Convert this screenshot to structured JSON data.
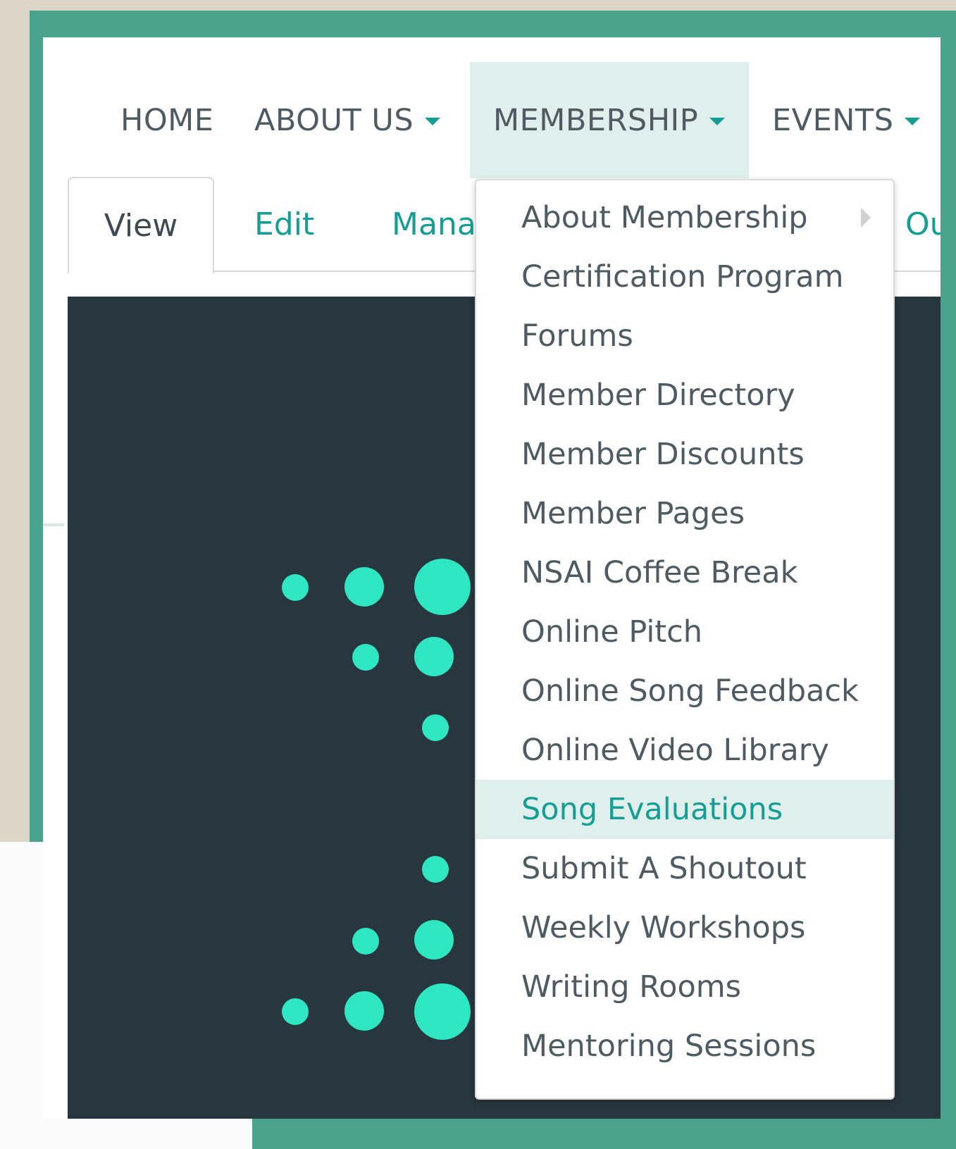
{
  "nav": {
    "items": [
      {
        "label": "HOME",
        "has_caret": false
      },
      {
        "label": "ABOUT US",
        "has_caret": true
      },
      {
        "label": "MEMBERSHIP",
        "has_caret": true,
        "active": true
      },
      {
        "label": "EVENTS",
        "has_caret": true
      }
    ]
  },
  "tabs": {
    "items": [
      {
        "label": "View",
        "active": true
      },
      {
        "label": "Edit"
      },
      {
        "label": "Manage"
      },
      {
        "label": "Outline"
      }
    ]
  },
  "dropdown": {
    "items": [
      {
        "label": "About Membership",
        "has_submenu": true
      },
      {
        "label": "Certification Program"
      },
      {
        "label": "Forums"
      },
      {
        "label": "Member Directory"
      },
      {
        "label": "Member Discounts"
      },
      {
        "label": "Member Pages"
      },
      {
        "label": "NSAI Coffee Break"
      },
      {
        "label": "Online Pitch"
      },
      {
        "label": "Online Song Feedback"
      },
      {
        "label": "Online Video Library"
      },
      {
        "label": "Song Evaluations",
        "hovered": true
      },
      {
        "label": "Submit A Shoutout"
      },
      {
        "label": "Weekly Workshops"
      },
      {
        "label": "Writing Rooms"
      },
      {
        "label": "Mentoring Sessions"
      }
    ]
  },
  "colors": {
    "accent": "#169e94",
    "frame_teal": "#4aa48d",
    "frame_beige": "#ddd6c8",
    "hero_bg": "#27373d",
    "dot": "#2ee6c2",
    "highlight": "#dff0ec",
    "text": "#4f5b63"
  },
  "icons": {
    "caret": "caret-down-icon",
    "submenu": "caret-right-icon"
  }
}
